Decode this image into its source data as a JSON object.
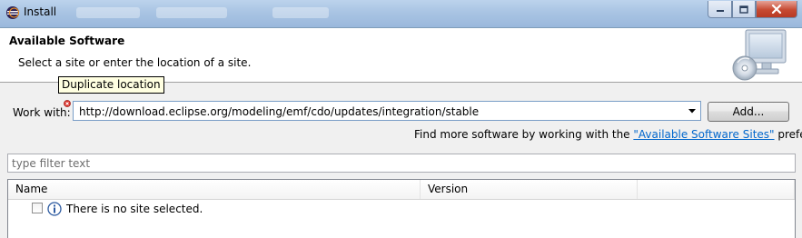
{
  "window": {
    "title": "Install",
    "buttons": {
      "minimize": "minimize",
      "maximize": "maximize",
      "close": "close"
    }
  },
  "header": {
    "heading": "Available Software",
    "description": "Select a site or enter the location of a site."
  },
  "tooltip": {
    "text": "Duplicate location"
  },
  "work_with": {
    "label": "Work with:",
    "value": "http://download.eclipse.org/modeling/emf/cdo/updates/integration/stable",
    "add_label": "Add..."
  },
  "find_more": {
    "prefix": "Find more software by working with the ",
    "link": "\"Available Software Sites\"",
    "suffix": " preferences."
  },
  "filter": {
    "placeholder": "type filter text"
  },
  "table": {
    "columns": [
      "Name",
      "Version"
    ],
    "rows": [
      {
        "label": "There is no site selected."
      }
    ]
  },
  "colors": {
    "link": "#0066cc",
    "tooltip_bg": "#ffffe1",
    "error": "#d9322b"
  }
}
